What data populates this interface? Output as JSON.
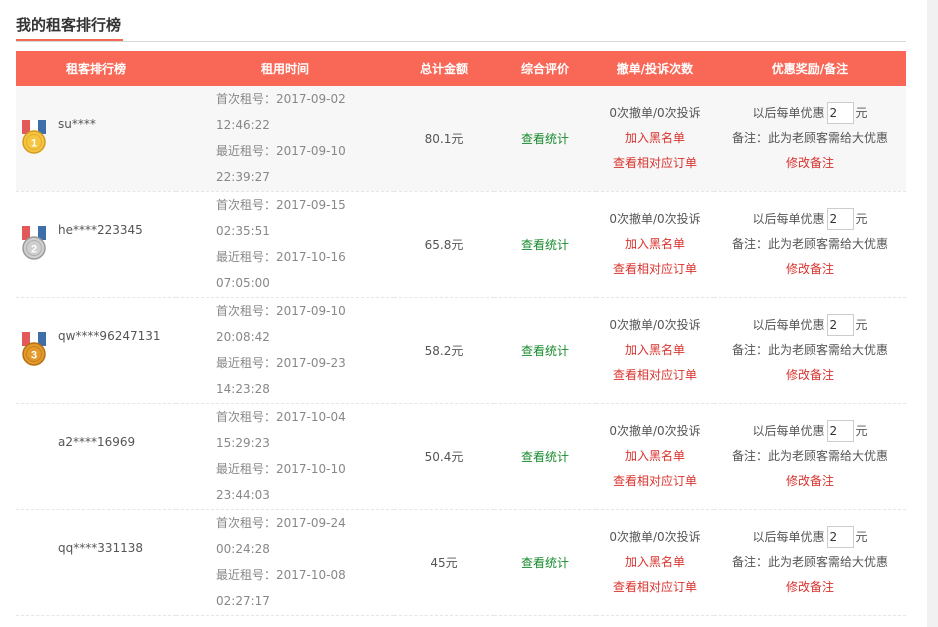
{
  "page": {
    "title": "我的租客排行榜"
  },
  "table": {
    "headers": [
      "租客排行榜",
      "租用时间",
      "总计金额",
      "综合评价",
      "撤单/投诉次数",
      "优惠奖励/备注"
    ]
  },
  "colors": {
    "header_bg": "#f96857",
    "accent": "#f26a57",
    "link_green": "#178a2d",
    "link_red": "#d9332e",
    "gold": "#f5c542",
    "silver": "#cfcfcf",
    "bronze": "#e39a2b"
  },
  "rows": [
    {
      "medal": "gold-medal-icon",
      "rank": "1",
      "user": "su****",
      "first": "首次租号：2017-09-02 12:46:22",
      "last": "最近租号：2017-09-10 22:39:27",
      "amount": "80.1元",
      "review": "查看统计",
      "counts": "0次撤单/0次投诉",
      "blacklist": "加入黑名单",
      "orders": "查看相对应订单",
      "discount_label": "以后每单优惠",
      "discount_value": "2",
      "discount_unit": "元",
      "note": "备注：此为老顾客需给大优惠",
      "edit": "修改备注"
    },
    {
      "medal": "silver-medal-icon",
      "rank": "2",
      "user": "he****223345",
      "first": "首次租号：2017-09-15 02:35:51",
      "last": "最近租号：2017-10-16 07:05:00",
      "amount": "65.8元",
      "review": "查看统计",
      "counts": "0次撤单/0次投诉",
      "blacklist": "加入黑名单",
      "orders": "查看相对应订单",
      "discount_label": "以后每单优惠",
      "discount_value": "2",
      "discount_unit": "元",
      "note": "备注：此为老顾客需给大优惠",
      "edit": "修改备注"
    },
    {
      "medal": "bronze-medal-icon",
      "rank": "3",
      "user": "qw****96247131",
      "first": "首次租号：2017-09-10 20:08:42",
      "last": "最近租号：2017-09-23 14:23:28",
      "amount": "58.2元",
      "review": "查看统计",
      "counts": "0次撤单/0次投诉",
      "blacklist": "加入黑名单",
      "orders": "查看相对应订单",
      "discount_label": "以后每单优惠",
      "discount_value": "2",
      "discount_unit": "元",
      "note": "备注：此为老顾客需给大优惠",
      "edit": "修改备注"
    },
    {
      "medal": "",
      "rank": "",
      "user": "a2****16969",
      "first": "首次租号：2017-10-04 15:29:23",
      "last": "最近租号：2017-10-10 23:44:03",
      "amount": "50.4元",
      "review": "查看统计",
      "counts": "0次撤单/0次投诉",
      "blacklist": "加入黑名单",
      "orders": "查看相对应订单",
      "discount_label": "以后每单优惠",
      "discount_value": "2",
      "discount_unit": "元",
      "note": "备注：此为老顾客需给大优惠",
      "edit": "修改备注"
    },
    {
      "medal": "",
      "rank": "",
      "user": "qq****331138",
      "first": "首次租号：2017-09-24 00:24:28",
      "last": "最近租号：2017-10-08 02:27:17",
      "amount": "45元",
      "review": "查看统计",
      "counts": "0次撤单/0次投诉",
      "blacklist": "加入黑名单",
      "orders": "查看相对应订单",
      "discount_label": "以后每单优惠",
      "discount_value": "2",
      "discount_unit": "元",
      "note": "备注：此为老顾客需给大优惠",
      "edit": "修改备注"
    }
  ]
}
